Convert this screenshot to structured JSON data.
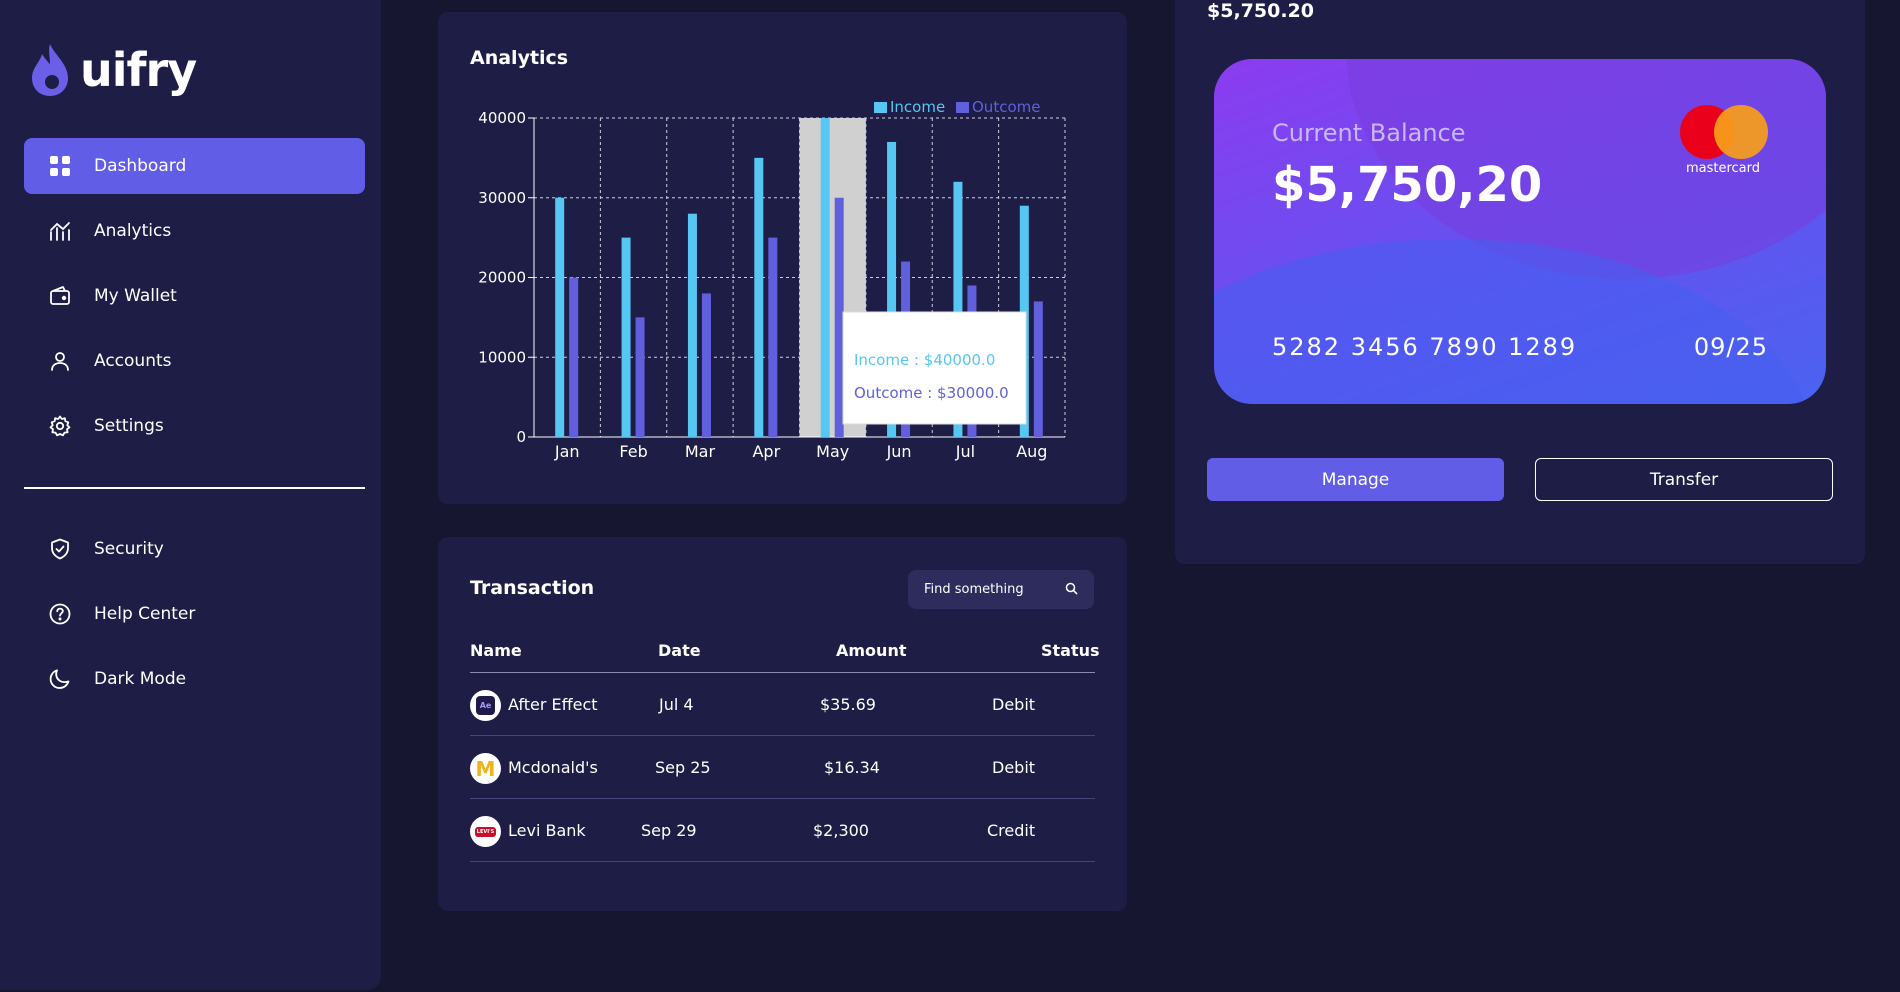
{
  "app": {
    "name": "uifry"
  },
  "sidebar": {
    "primary": [
      {
        "label": "Dashboard",
        "icon": "grid-icon",
        "active": true
      },
      {
        "label": "Analytics",
        "icon": "analytics-icon",
        "active": false
      },
      {
        "label": "My Wallet",
        "icon": "wallet-icon",
        "active": false
      },
      {
        "label": "Accounts",
        "icon": "user-icon",
        "active": false
      },
      {
        "label": "Settings",
        "icon": "gear-icon",
        "active": false
      }
    ],
    "secondary": [
      {
        "label": "Security",
        "icon": "shield-icon"
      },
      {
        "label": "Help Center",
        "icon": "help-icon"
      },
      {
        "label": "Dark Mode",
        "icon": "moon-icon"
      }
    ]
  },
  "analytics": {
    "title": "Analytics",
    "tooltip": {
      "income": "Income : $40000.0",
      "outcome": "Outcome : $30000.0"
    }
  },
  "chart_data": {
    "type": "bar",
    "categories": [
      "Jan",
      "Feb",
      "Mar",
      "Apr",
      "May",
      "Jun",
      "Jul",
      "Aug"
    ],
    "series": [
      {
        "name": "Income",
        "color": "#55c7f2",
        "values": [
          30000,
          25000,
          28000,
          35000,
          40000,
          37000,
          32000,
          29000
        ]
      },
      {
        "name": "Outcome",
        "color": "#6160dc",
        "values": [
          20000,
          15000,
          18000,
          25000,
          30000,
          22000,
          19000,
          17000
        ]
      }
    ],
    "ylim": [
      0,
      40000
    ],
    "yticks": [
      0,
      10000,
      20000,
      30000,
      40000
    ],
    "grid": true,
    "legend": "top-right",
    "highlighted_category": "May"
  },
  "transaction": {
    "title": "Transaction",
    "search_placeholder": "Find something",
    "columns": [
      "Name",
      "Date",
      "Amount",
      "Status"
    ],
    "rows": [
      {
        "name": "After Effect",
        "date": "Jul 4",
        "amount": "$35.69",
        "status": "Debit",
        "avatar": "Ae"
      },
      {
        "name": "Mcdonald's",
        "date": "Sep 25",
        "amount": "$16.34",
        "status": "Debit",
        "avatar": "M"
      },
      {
        "name": "Levi Bank",
        "date": "Sep 29",
        "amount": "$2,300",
        "status": "Credit",
        "avatar": "LEVI'S"
      }
    ]
  },
  "wallet": {
    "balance_header": "$5,750.20",
    "card": {
      "label": "Current Balance",
      "amount": "$5,750,20",
      "number": "5282 3456 7890 1289",
      "expiry": "09/25",
      "brand": "mastercard"
    },
    "manage_label": "Manage",
    "transfer_label": "Transfer"
  },
  "colors": {
    "background": "#161630",
    "panel": "#1e1d45",
    "accent": "#615de6",
    "income": "#55c7f2",
    "outcome": "#6160dc"
  }
}
